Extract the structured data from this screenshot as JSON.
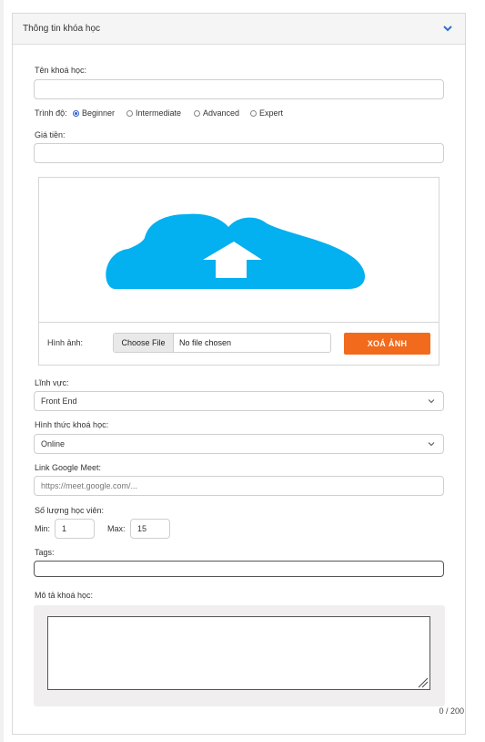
{
  "panel": {
    "title": "Thông tin khóa học"
  },
  "course_name": {
    "label": "Tên khoá học:",
    "value": ""
  },
  "level": {
    "label": "Trình độ:",
    "options": [
      "Beginner",
      "Intermediate",
      "Advanced",
      "Expert"
    ],
    "selected": "Beginner"
  },
  "price": {
    "label": "Giá tiền:",
    "value": ""
  },
  "image": {
    "label": "Hình ảnh:",
    "choose_file": "Choose File",
    "file_status": "No file chosen",
    "remove_label": "XOÁ ẢNH",
    "upload_icon_color": "#03b0f0"
  },
  "field": {
    "label": "Lĩnh vực:",
    "value": "Front End"
  },
  "format": {
    "label": "Hình thức khoá học:",
    "value": "Online"
  },
  "meet_link": {
    "label": "Link Google Meet:",
    "placeholder": "https://meet.google.com/..."
  },
  "students": {
    "label": "Số lượng học viên:",
    "min_label": "Min:",
    "min_value": "1",
    "max_label": "Max:",
    "max_value": "15"
  },
  "tags": {
    "label": "Tags:",
    "value": ""
  },
  "description": {
    "label": "Mô tả khoá học:",
    "value": "",
    "counter": "0 / 200"
  },
  "colors": {
    "accent": "#f26a1b",
    "link_blue": "#2a5bd7"
  }
}
